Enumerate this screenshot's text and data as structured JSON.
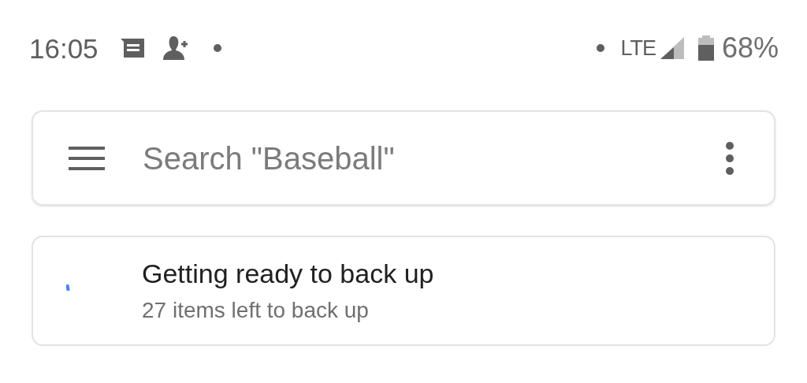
{
  "status_bar": {
    "time": "16:05",
    "network": "LTE",
    "battery": "68%"
  },
  "search": {
    "placeholder": "Search \"Baseball\""
  },
  "backup_card": {
    "title": "Getting ready to back up",
    "subtitle": "27 items left to back up"
  }
}
